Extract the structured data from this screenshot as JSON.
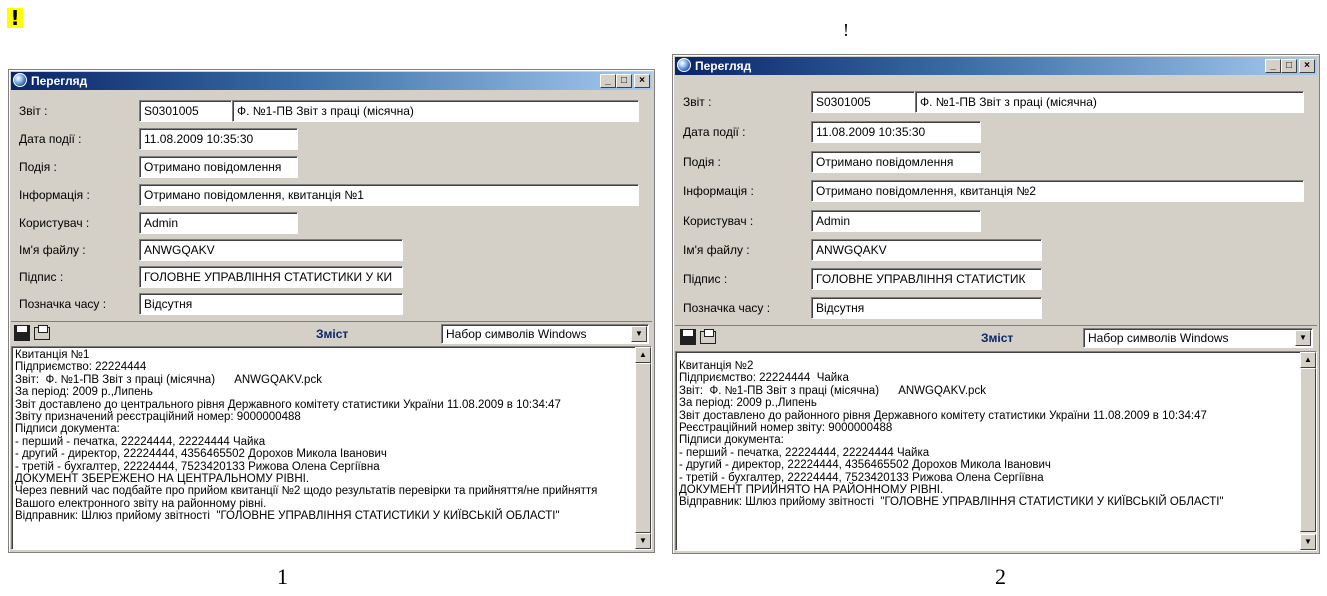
{
  "marks": {
    "warning": "!",
    "top_center": "!"
  },
  "captions": {
    "left": "1",
    "right": "2"
  },
  "windows": [
    {
      "title": "Перегляд",
      "labels": {
        "report": "Звіт :",
        "event_date": "Дата події :",
        "event": "Подія :",
        "info": "Інформація :",
        "user": "Користувач :",
        "file_name": "Ім'я файлу :",
        "signature": "Підпис :",
        "timestamp": "Позначка часу :"
      },
      "values": {
        "report_code": "S0301005",
        "report_name": "Ф. №1-ПВ Звіт з праці (місячна)",
        "event_date": "11.08.2009 10:35:30",
        "event": "Отримано повідомлення",
        "info": "Отримано повідомлення, квитанція №1",
        "user": "Admin",
        "file_name": "ANWGQAKV",
        "signature": "ГОЛОВНЕ УПРАВЛІННЯ СТАТИСТИКИ У КИ",
        "timestamp": "Відсутня"
      },
      "toolbar": {
        "contents": "Зміст",
        "encoding": "Набор символів Windows"
      },
      "text": [
        "Квитанція №1",
        "Підприємство: 22224444",
        "Звіт:  Ф. №1-ПВ Звіт з праці (місячна)      ANWGQAKV.pck",
        "За період: 2009 р.,Липень",
        "Звіт доставлено до центрального рівня Державного комітету статистики України 11.08.2009 в 10:34:47",
        "Звіту призначений реєстраційний номер: 9000000488",
        "Підписи документа:",
        "- перший - печатка, 22224444, 22224444 Чайка",
        "- другий - директор, 22224444, 4356465502 Дорохов Микола Іванович",
        "- третій - бухгалтер, 22224444, 7523420133 Рижова Олена Сергіївна",
        "ДОКУМЕНТ ЗБЕРЕЖЕНО НА ЦЕНТРАЛЬНОМУ РІВНІ.",
        "Через певний час подбайте про прийом квитанції №2 щодо результатів перевірки та прийняття/не прийняття",
        "Вашого електронного звіту на районному рівні.",
        "Відправник: Шлюз прийому звітності  \"ГОЛОВНЕ УПРАВЛІННЯ СТАТИСТИКИ У КИЇВСЬКІЙ ОБЛАСТІ\""
      ]
    },
    {
      "title": "Перегляд",
      "labels": {
        "report": "Звіт :",
        "event_date": "Дата події :",
        "event": "Подія :",
        "info": "Інформація :",
        "user": "Користувач :",
        "file_name": "Ім'я файлу :",
        "signature": "Підпис :",
        "timestamp": "Позначка часу :"
      },
      "values": {
        "report_code": "S0301005",
        "report_name": "Ф. №1-ПВ Звіт з праці (місячна)",
        "event_date": "11.08.2009 10:35:30",
        "event": "Отримано повідомлення",
        "info": "Отримано повідомлення, квитанція №2",
        "user": "Admin",
        "file_name": "ANWGQAKV",
        "signature": "ГОЛОВНЕ УПРАВЛІННЯ СТАТИСТИК",
        "timestamp": "Відсутня"
      },
      "toolbar": {
        "contents": "Зміст",
        "encoding": "Набор символів Windows"
      },
      "text": [
        "Квитанція №2",
        "Підприємство: 22224444  Чайка",
        "Звіт:  Ф. №1-ПВ Звіт з праці (місячна)      ANWGQAKV.pck",
        "За період: 2009 р.,Липень",
        "Звіт доставлено до районного рівня Державного комітету статистики України 11.08.2009 в 10:34:47",
        "Реєстраційний номер звіту: 9000000488",
        "Підписи документа:",
        "- перший - печатка, 22224444, 22224444 Чайка",
        "- другий - директор, 22224444, 4356465502 Дорохов Микола Іванович",
        "- третій - бухгалтер, 22224444, 7523420133 Рижова Олена Сергіївна",
        "ДОКУМЕНТ ПРИЙНЯТО НА РАЙОННОМУ РІВНІ.",
        "Відправник: Шлюз прийому звітності  \"ГОЛОВНЕ УПРАВЛІННЯ СТАТИСТИКИ У КИЇВСЬКІЙ ОБЛАСТІ\""
      ]
    }
  ]
}
